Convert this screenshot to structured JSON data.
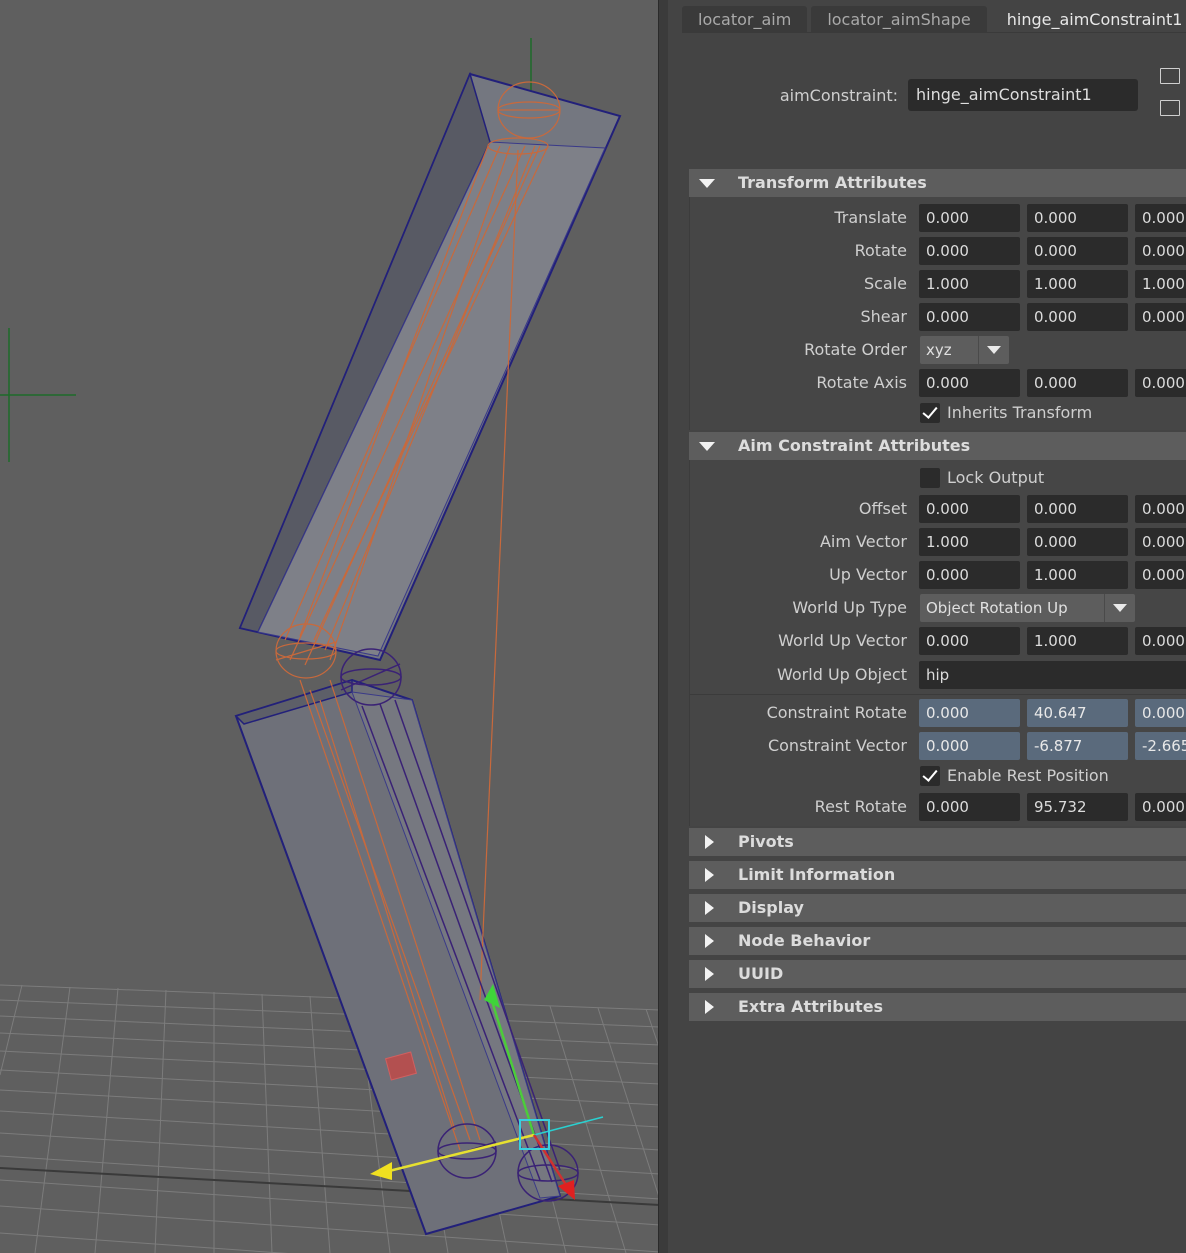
{
  "tabs": [
    "locator_aim",
    "locator_aimShape",
    "hinge_aimConstraint1"
  ],
  "active_tab": 2,
  "node": {
    "label": "aimConstraint:",
    "value": "hinge_aimConstraint1"
  },
  "sections": {
    "transform": {
      "title": "Transform Attributes",
      "translate": {
        "label": "Translate",
        "v": [
          "0.000",
          "0.000",
          "0.000"
        ]
      },
      "rotate": {
        "label": "Rotate",
        "v": [
          "0.000",
          "0.000",
          "0.000"
        ]
      },
      "scale": {
        "label": "Scale",
        "v": [
          "1.000",
          "1.000",
          "1.000"
        ]
      },
      "shear": {
        "label": "Shear",
        "v": [
          "0.000",
          "0.000",
          "0.000"
        ]
      },
      "rotate_order": {
        "label": "Rotate Order",
        "value": "xyz"
      },
      "rotate_axis": {
        "label": "Rotate Axis",
        "v": [
          "0.000",
          "0.000",
          "0.000"
        ]
      },
      "inherits_transform": {
        "label": "Inherits Transform",
        "checked": true
      }
    },
    "aim": {
      "title": "Aim Constraint Attributes",
      "lock_output": {
        "label": "Lock Output",
        "checked": false
      },
      "offset": {
        "label": "Offset",
        "v": [
          "0.000",
          "0.000",
          "0.000"
        ]
      },
      "aim_vector": {
        "label": "Aim Vector",
        "v": [
          "1.000",
          "0.000",
          "0.000"
        ]
      },
      "up_vector": {
        "label": "Up Vector",
        "v": [
          "0.000",
          "1.000",
          "0.000"
        ]
      },
      "world_up_type": {
        "label": "World Up Type",
        "value": "Object Rotation Up"
      },
      "world_up_vector": {
        "label": "World Up Vector",
        "v": [
          "0.000",
          "1.000",
          "0.000"
        ]
      },
      "world_up_object": {
        "label": "World Up Object",
        "value": "hip"
      },
      "constraint_rotate": {
        "label": "Constraint Rotate",
        "v": [
          "0.000",
          "40.647",
          "0.000"
        ]
      },
      "constraint_vector": {
        "label": "Constraint Vector",
        "v": [
          "0.000",
          "-6.877",
          "-2.665"
        ]
      },
      "enable_rest": {
        "label": "Enable Rest Position",
        "checked": true
      },
      "rest_rotate": {
        "label": "Rest Rotate",
        "v": [
          "0.000",
          "95.732",
          "0.000"
        ]
      }
    },
    "collapsed": [
      "Pivots",
      "Limit Information",
      "Display",
      "Node Behavior",
      "UUID",
      "Extra Attributes"
    ]
  },
  "colors": {
    "viewport_bg": "#5f5f5f",
    "panel_bg": "#444444",
    "field_bg": "#2b2b2b",
    "readonly_field_bg": "#5a6a7c",
    "section_header_bg": "#5d5d5d",
    "joint_wire": "#c8693c",
    "selection_wire": "#2a2080"
  }
}
